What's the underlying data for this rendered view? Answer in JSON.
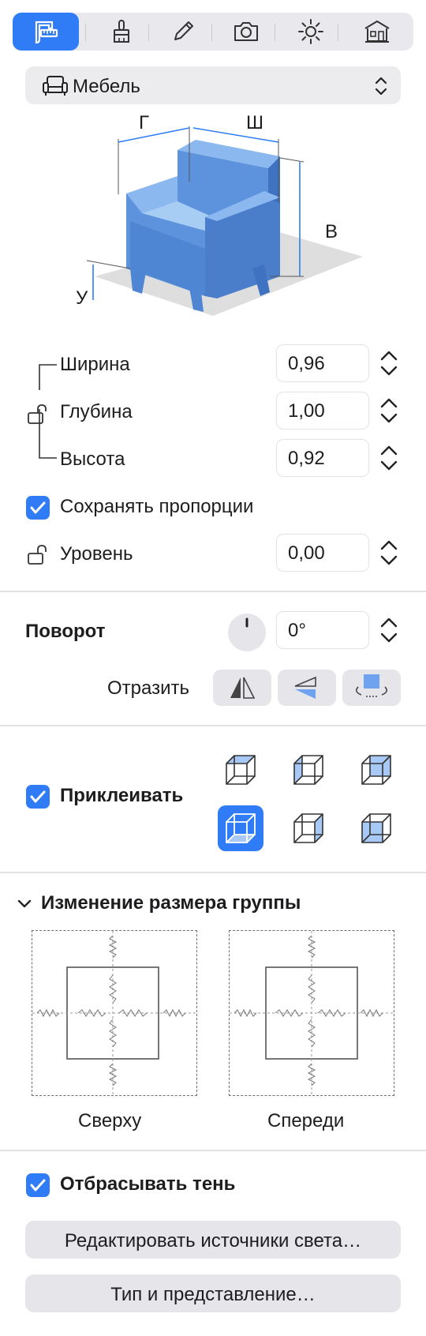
{
  "toolbar": {
    "tabs": [
      {
        "icon": "caliper-icon",
        "active": true
      },
      {
        "icon": "brush-icon",
        "active": false
      },
      {
        "icon": "pencil-icon",
        "active": false
      },
      {
        "icon": "camera-icon",
        "active": false
      },
      {
        "icon": "sun-icon",
        "active": false
      },
      {
        "icon": "house-icon",
        "active": false
      }
    ]
  },
  "category": {
    "icon": "armchair-icon",
    "label": "Мебель"
  },
  "preview": {
    "depth_label": "Г",
    "width_label": "Ш",
    "height_label": "В",
    "elevation_label": "У"
  },
  "dimensions": {
    "width_label": "Ширина",
    "width_value": "0,96",
    "depth_label": "Глубина",
    "depth_value": "1,00",
    "height_label": "Высота",
    "height_value": "0,92",
    "keep_proportions_label": "Сохранять пропорции",
    "level_label": "Уровень",
    "level_value": "0,00"
  },
  "rotation": {
    "label": "Поворот",
    "value": "0°",
    "mirror_label": "Отразить"
  },
  "glue": {
    "label": "Приклеивать"
  },
  "group_resize": {
    "title": "Изменение размера группы",
    "top_label": "Сверху",
    "front_label": "Спереди"
  },
  "shadow": {
    "label": "Отбрасывать тень"
  },
  "buttons": {
    "edit_lights": "Редактировать источники света…",
    "type_view": "Тип и представление…"
  },
  "colors": {
    "accent": "#2f7cf6",
    "chair": "#5d93dc"
  }
}
